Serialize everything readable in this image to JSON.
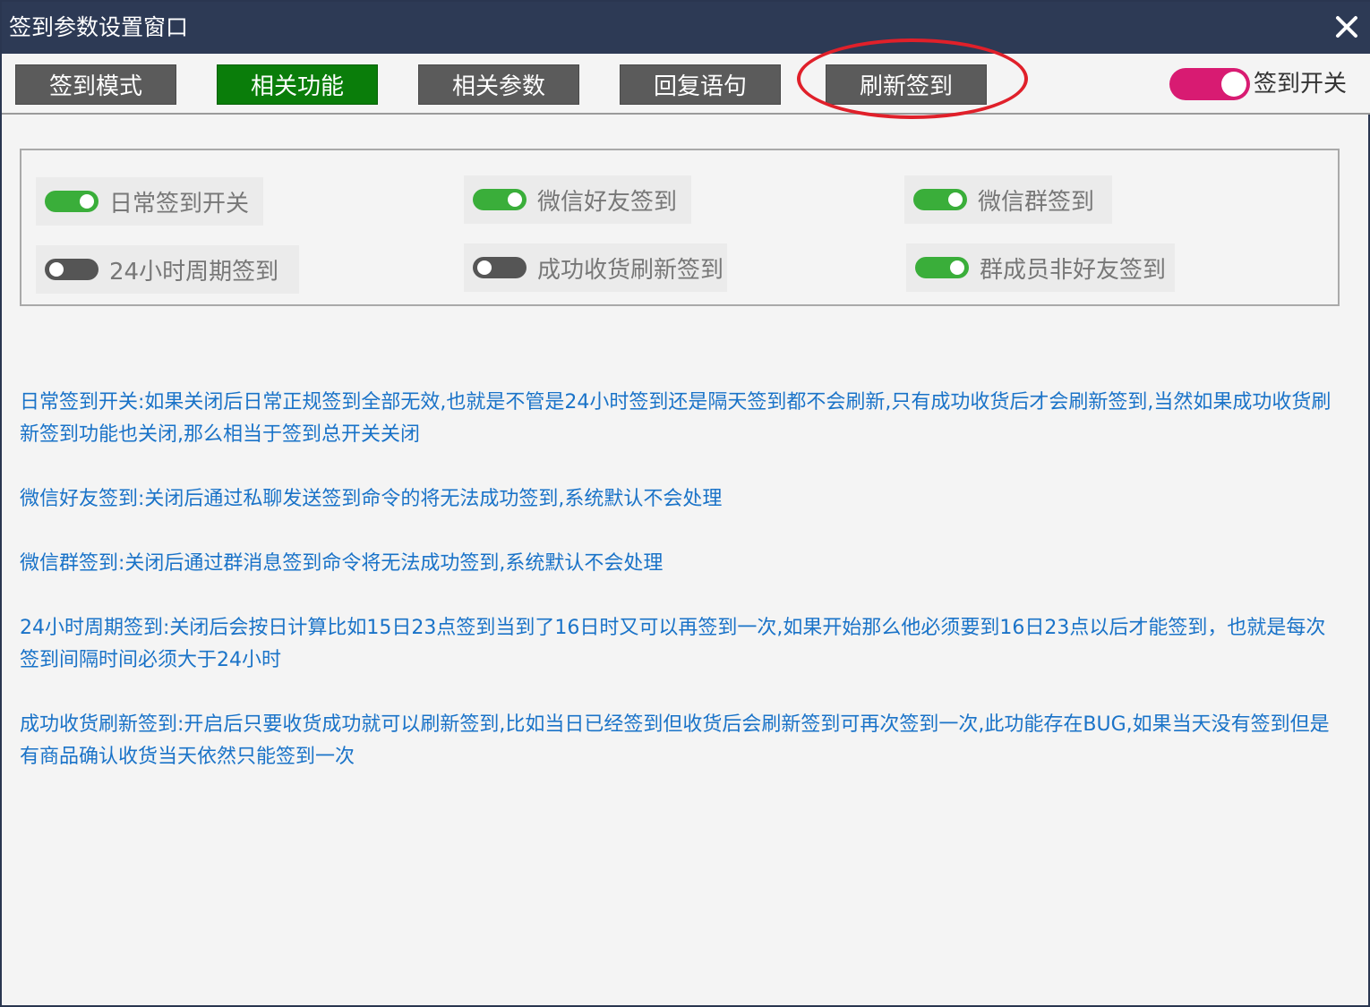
{
  "window": {
    "title": "签到参数设置窗口"
  },
  "tabs": [
    {
      "label": "签到模式",
      "active": false
    },
    {
      "label": "相关功能",
      "active": true
    },
    {
      "label": "相关参数",
      "active": false
    },
    {
      "label": "回复语句",
      "active": false
    },
    {
      "label": "刷新签到",
      "active": false
    }
  ],
  "master_switch": {
    "label": "签到开关",
    "on": true,
    "color": "#d81b72"
  },
  "options": [
    {
      "label": "日常签到开关",
      "on": true
    },
    {
      "label": "微信好友签到",
      "on": true
    },
    {
      "label": "微信群签到",
      "on": true
    },
    {
      "label": "24小时周期签到",
      "on": false
    },
    {
      "label": "成功收货刷新签到",
      "on": false
    },
    {
      "label": "群成员非好友签到",
      "on": true
    }
  ],
  "descriptions": [
    "日常签到开关:如果关闭后日常正规签到全部无效,也就是不管是24小时签到还是隔天签到都不会刷新,只有成功收货后才会刷新签到,当然如果成功收货刷新签到功能也关闭,那么相当于签到总开关关闭",
    "微信好友签到:关闭后通过私聊发送签到命令的将无法成功签到,系统默认不会处理",
    "微信群签到:关闭后通过群消息签到命令将无法成功签到,系统默认不会处理",
    "24小时周期签到:关闭后会按日计算比如15日23点签到当到了16日时又可以再签到一次,如果开始那么他必须要到16日23点以后才能签到，也就是每次签到间隔时间必须大于24小时",
    "成功收货刷新签到:开启后只要收货成功就可以刷新签到,比如当日已经签到但收货后会刷新签到可再次签到一次,此功能存在BUG,如果当天没有签到但是有商品确认收货当天依然只能签到一次"
  ],
  "colors": {
    "titlebar": "#2d3a55",
    "tab_active": "#0a7d0a",
    "tab_inactive": "#5b5b5b",
    "switch_on": "#3aae3a",
    "switch_off": "#555555",
    "description_text": "#1a73c8",
    "highlight": "#e0202a"
  },
  "icons": {
    "close": "close-icon"
  }
}
